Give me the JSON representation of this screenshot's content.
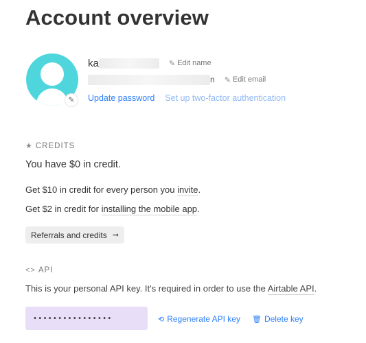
{
  "page": {
    "title": "Account overview"
  },
  "profile": {
    "name_visible": "ka",
    "edit_name": "Edit name",
    "email_visible_tail": "n",
    "edit_email": "Edit email",
    "update_password": "Update password",
    "two_factor": "Set up two-factor authentication",
    "avatar_color": "#4fd6dd"
  },
  "credits": {
    "section_label": "CREDITS",
    "balance": "You have $0 in credit.",
    "invite_prefix": "Get $10 in credit for every person you ",
    "invite_link": "invite",
    "invite_suffix": ".",
    "mobile_prefix": "Get $2 in credit for ",
    "mobile_link": "installing the mobile app",
    "mobile_suffix": ".",
    "referrals_button": "Referrals and credits"
  },
  "api": {
    "section_label": "API",
    "description_prefix": "This is your personal API key. It's required in order to use the ",
    "description_link": "Airtable API",
    "description_suffix": ".",
    "masked_key": "••••••••••••••••",
    "regenerate": "Regenerate API key",
    "delete": "Delete key",
    "key_field_color": "#e8def8",
    "link_color": "#2d7ff9"
  }
}
